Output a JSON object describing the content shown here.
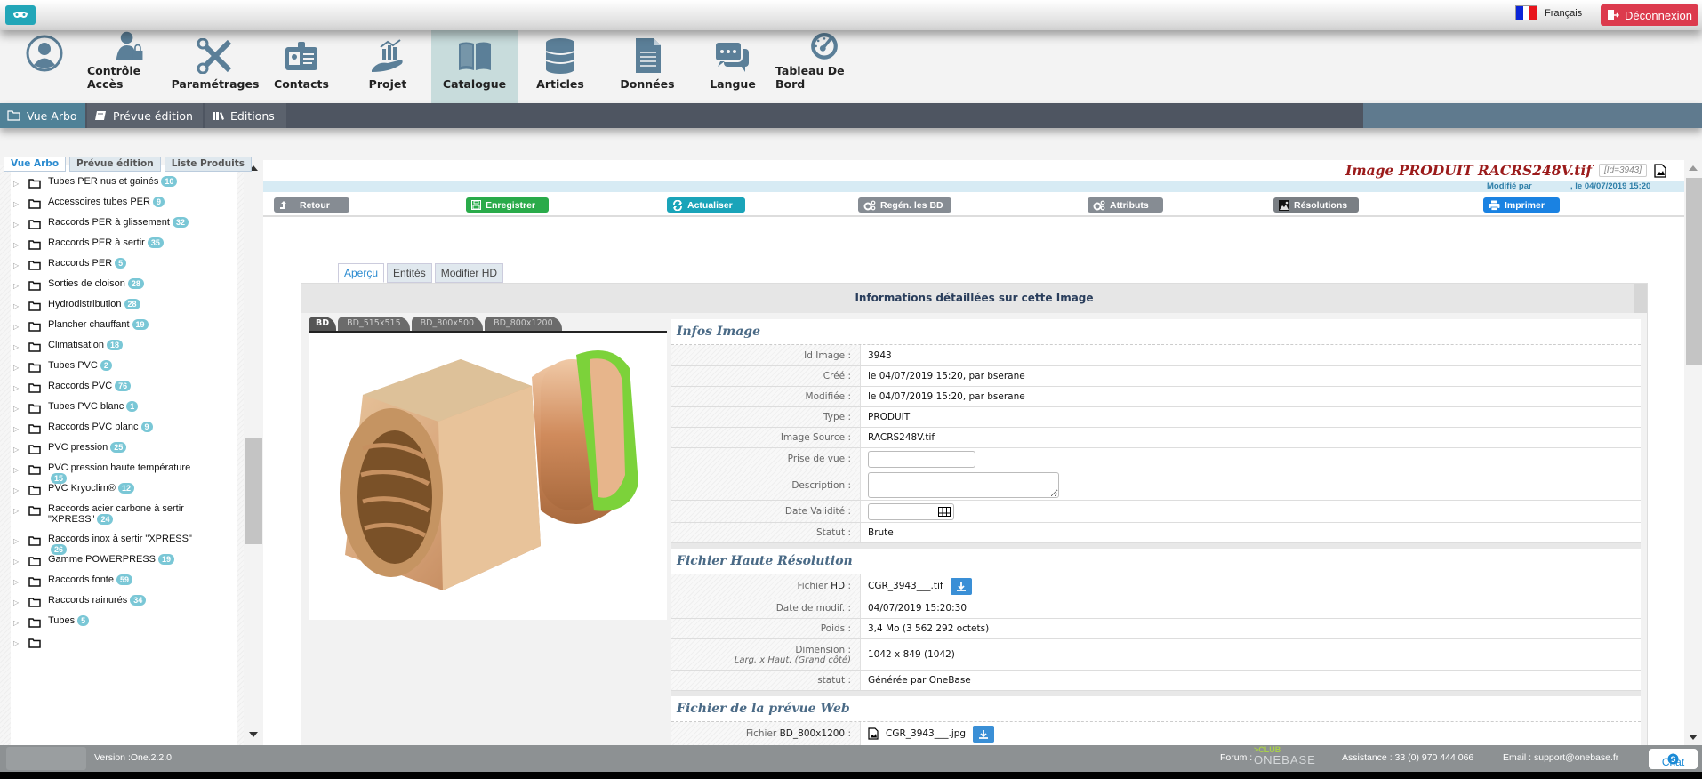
{
  "topbar": {
    "language": "Français",
    "logout_label": "Déconnexion"
  },
  "main_nav": [
    {
      "label": "",
      "icon": "user-avatar-icon"
    },
    {
      "label": "Contrôle Accès",
      "icon": "user-lock-icon"
    },
    {
      "label": "Paramétrages",
      "icon": "tools-icon"
    },
    {
      "label": "Contacts",
      "icon": "id-card-icon"
    },
    {
      "label": "Projet",
      "icon": "hand-chart-icon"
    },
    {
      "label": "Catalogue",
      "icon": "book-icon",
      "active": true
    },
    {
      "label": "Articles",
      "icon": "database-icon"
    },
    {
      "label": "Données",
      "icon": "document-icon"
    },
    {
      "label": "Langue",
      "icon": "chat-bubbles-icon"
    },
    {
      "label": "Tableau De Bord",
      "icon": "dashboard-gauge-icon"
    }
  ],
  "sub_nav": [
    {
      "label": "Vue Arbo",
      "icon": "folder-icon",
      "active": true
    },
    {
      "label": "Prévue édition",
      "icon": "book-edit-icon"
    },
    {
      "label": "Editions",
      "icon": "library-icon"
    }
  ],
  "left_tabs": [
    "Vue Arbo",
    "Prévue édition",
    "Liste Produits"
  ],
  "tree": [
    {
      "label": "Tubes PER nus et gainés",
      "count": "10"
    },
    {
      "label": "Accessoires tubes PER",
      "count": "9"
    },
    {
      "label": "Raccords PER à glissement",
      "count": "32"
    },
    {
      "label": "Raccords PER à sertir",
      "count": "35"
    },
    {
      "label": "Raccords PER",
      "count": "5"
    },
    {
      "label": "Sorties de cloison",
      "count": "28"
    },
    {
      "label": "Hydrodistribution",
      "count": "28"
    },
    {
      "label": "Plancher chauffant",
      "count": "19"
    },
    {
      "label": "Climatisation",
      "count": "18"
    },
    {
      "label": "Tubes PVC",
      "count": "2"
    },
    {
      "label": "Raccords PVC",
      "count": "76"
    },
    {
      "label": "Tubes PVC blanc",
      "count": "1"
    },
    {
      "label": "Raccords PVC blanc",
      "count": "9"
    },
    {
      "label": "PVC pression",
      "count": "25"
    },
    {
      "label": "PVC pression haute température",
      "count": "15"
    },
    {
      "label": "PVC Kryoclim®",
      "count": "12"
    },
    {
      "label": "Raccords acier carbone à sertir \"XPRESS\"",
      "count": "24"
    },
    {
      "label": "Raccords inox à sertir \"XPRESS\"",
      "count": "26"
    },
    {
      "label": "Gamme POWERPRESS",
      "count": "19"
    },
    {
      "label": "Raccords fonte",
      "count": "59"
    },
    {
      "label": "Raccords rainurés",
      "count": "34"
    },
    {
      "label": "Tubes",
      "count": "5"
    }
  ],
  "header": {
    "title": "Image PRODUIT RACRS248V.tif",
    "id_tag": "[Id=3943]",
    "modified_by_label": "Modifié par",
    "modified_date": ", le 04/07/2019 15:20"
  },
  "toolbar": {
    "retour": "Retour",
    "enregistrer": "Enregistrer",
    "actualiser": "Actualiser",
    "regen": "Regén. les BD",
    "attributs": "Attributs",
    "resolutions": "Résolutions",
    "imprimer": "Imprimer"
  },
  "main_tabs": [
    "Aperçu",
    "Entités",
    "Modifier HD"
  ],
  "panel_title": "Informations détaillées sur cette Image",
  "image_tabs": [
    "BD",
    "BD_515x515",
    "BD_800x500",
    "BD_800x1200"
  ],
  "infos_image": {
    "title": "Infos Image",
    "rows": [
      {
        "key": "Id Image :",
        "value": "3943"
      },
      {
        "key": "Créé :",
        "value": "le 04/07/2019 15:20, par bserane"
      },
      {
        "key": "Modifiée :",
        "value": "le 04/07/2019 15:20, par bserane"
      },
      {
        "key": "Type :",
        "value": "PRODUIT"
      },
      {
        "key": "Image Source :",
        "value": "RACRS248V.tif"
      },
      {
        "key": "Prise de vue :",
        "value": ""
      },
      {
        "key": "Description :",
        "value": ""
      },
      {
        "key": "Date Validité :",
        "value": ""
      },
      {
        "key": "Statut :",
        "value": "Brute"
      }
    ]
  },
  "fichier_hd": {
    "title": "Fichier Haute Résolution",
    "file_key_prefix": "Fichier",
    "file_key_bold": "HD",
    "file_key_suffix": " :",
    "file": "CGR_3943___.tif",
    "date_key": "Date de modif. :",
    "date": "04/07/2019 15:20:30",
    "poids_key": "Poids :",
    "poids": "3,4 Mo (3 562 292 octets)",
    "dim_key": "Dimension :",
    "dim_sub": "Larg. x Haut. (Grand côté)",
    "dim": "1042 x 849 (1042)",
    "statut_key": "statut :",
    "statut": "Générée par OneBase"
  },
  "fichier_web": {
    "title": "Fichier de la prévue Web",
    "file_key_prefix": "Fichier",
    "file_key_bold": "BD_800x1200",
    "file_key_suffix": " :",
    "file": "CGR_3943___.jpg"
  },
  "footer": {
    "version": "Version :One.2.2.0",
    "forum": "Forum :",
    "club_top": ">CLUB",
    "club_bottom": "ONEBASE",
    "assistance": "Assistance : 33 (0) 970 444 066",
    "email": "Email : support@onebase.fr",
    "chat": "Chat"
  },
  "colors": {
    "accent_teal": "#22a6b8",
    "logout_red": "#dc3a4d",
    "title_red": "#9b1b1b",
    "badge": "#7ac7d6",
    "nav_icon": "#5b7f98"
  }
}
